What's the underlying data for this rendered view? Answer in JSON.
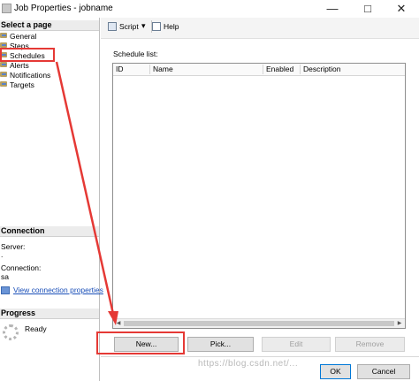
{
  "window": {
    "title": "Job Properties - jobname",
    "minimize": "—",
    "maximize": "□",
    "close": "✕"
  },
  "left_pane": {
    "select_page_header": "Select a page",
    "pages": [
      {
        "label": "General",
        "icon": "wrench-icon"
      },
      {
        "label": "Steps",
        "icon": "wrench-icon"
      },
      {
        "label": "Schedules",
        "icon": "wrench-icon",
        "selected": true
      },
      {
        "label": "Alerts",
        "icon": "wrench-icon"
      },
      {
        "label": "Notifications",
        "icon": "wrench-icon"
      },
      {
        "label": "Targets",
        "icon": "wrench-icon"
      }
    ],
    "connection_header": "Connection",
    "server_label": "Server:",
    "server_value": ".",
    "connection_label": "Connection:",
    "connection_value": "sa",
    "view_connection_link": "View connection properties",
    "progress_header": "Progress",
    "progress_status": "Ready"
  },
  "toolbar": {
    "script_label": "Script",
    "script_dropdown": "▾",
    "help_label": "Help"
  },
  "schedules": {
    "list_label": "Schedule list:",
    "columns": [
      "ID",
      "Name",
      "Enabled",
      "Description"
    ],
    "rows": []
  },
  "actions": {
    "new_label": "New...",
    "pick_label": "Pick...",
    "edit_label": "Edit",
    "remove_label": "Remove"
  },
  "dialog_buttons": {
    "ok_label": "OK",
    "cancel_label": "Cancel"
  },
  "watermark": "https://blog.csdn.net/...",
  "annotation_color": "#e53935"
}
